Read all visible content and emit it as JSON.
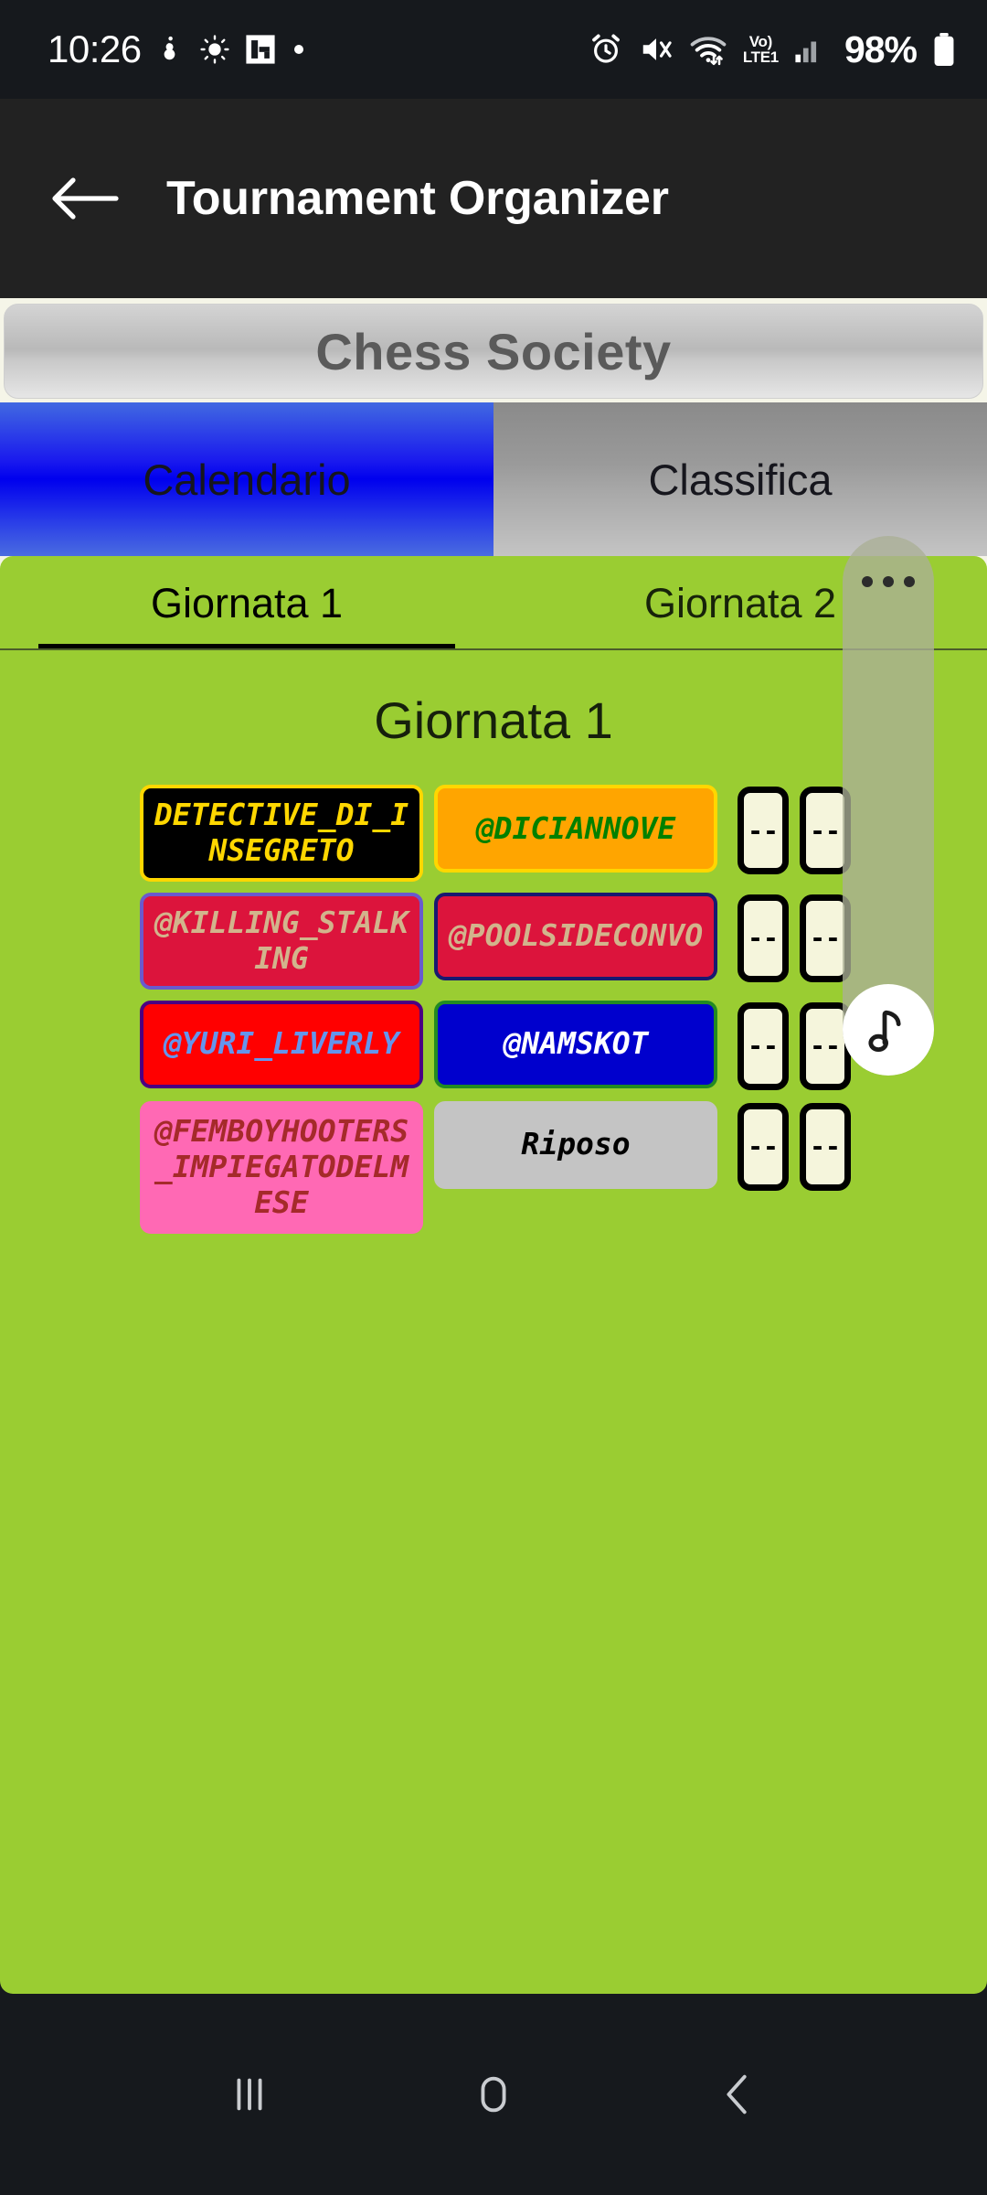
{
  "status_bar": {
    "time": "10:26",
    "battery_percent": "98%",
    "volte_top": "Vo)",
    "volte_bottom": "LTE1",
    "left_icons": [
      "clock-time",
      "do-not-disturb-icon",
      "brightness-icon",
      "flipboard-icon",
      "dot-indicator-icon"
    ],
    "right_icons": [
      "alarm-icon",
      "mute-icon",
      "wifi-icon",
      "volte-icon",
      "signal-bars-icon",
      "battery-icon"
    ]
  },
  "app_bar": {
    "back_icon": "back-arrow-icon",
    "title": "Tournament Organizer"
  },
  "society": {
    "name": "Chess Society"
  },
  "main_tabs": [
    {
      "label": "Calendario",
      "selected": true
    },
    {
      "label": "Classifica",
      "selected": false
    }
  ],
  "round_tabs": [
    {
      "label": "Giornata 1",
      "selected": true
    },
    {
      "label": "Giornata 2",
      "selected": false
    }
  ],
  "round_heading": "Giornata 1",
  "score_placeholder": "--",
  "colors": {
    "content_background": "#9acd32",
    "page_backdrop": "#f5f5e8",
    "selected_tab": "#0000ee",
    "unselected_tab": "#a8a8a8",
    "score_box_fill": "#f5f5dc"
  },
  "matches": [
    {
      "home": {
        "name": "DETECTIVE_DI_INSEGRETO",
        "bg": "#000000",
        "text": "#ffd700",
        "border": "#ffd700"
      },
      "away": {
        "name": "@DICIANNOVE",
        "bg": "#ffa500",
        "text": "#008000",
        "border": "#ffd700"
      },
      "home_score": "--",
      "away_score": "--"
    },
    {
      "home": {
        "name": "@KILLING_STALKING",
        "bg": "#dc143c",
        "text": "#d2b48c",
        "border": "#6a5acd"
      },
      "away": {
        "name": "@POOLSIDECONVO",
        "bg": "#dc143c",
        "text": "#d2b48c",
        "border": "#191970"
      },
      "home_score": "--",
      "away_score": "--"
    },
    {
      "home": {
        "name": "@YURI_LIVERLY",
        "bg": "#ff0000",
        "text": "#6495ed",
        "border": "#4b0082"
      },
      "away": {
        "name": "@NAMSKOT",
        "bg": "#0000cd",
        "text": "#ffffff",
        "border": "#228b22"
      },
      "home_score": "--",
      "away_score": "--"
    },
    {
      "home": {
        "name": "@FEMBOYHOOTERS_IMPIEGATODELMESE",
        "bg": "#ff69b4",
        "text": "#a52a2a",
        "border": "#ff69b4"
      },
      "away": {
        "name": "Riposo",
        "bg": "#c4c4c4",
        "text": "#000000",
        "border": "#c4c4c4"
      },
      "home_score": "--",
      "away_score": "--"
    }
  ],
  "floating_widget": {
    "menu_icon": "three-dots-icon",
    "music_icon": "music-note-icon"
  },
  "nav_bar": {
    "recents_icon": "recents-icon",
    "home_icon": "home-icon",
    "back_icon": "nav-back-icon"
  }
}
